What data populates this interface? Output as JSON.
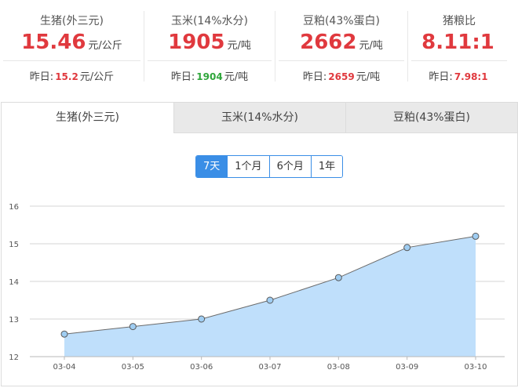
{
  "stats": [
    {
      "name": "生猪(外三元)",
      "value": "15.46",
      "unit": "元/公斤",
      "prev_label": "昨日:",
      "prev_value": "15.2",
      "prev_unit": "元/公斤",
      "prev_color": "red"
    },
    {
      "name": "玉米(14%水分)",
      "value": "1905",
      "unit": "元/吨",
      "prev_label": "昨日:",
      "prev_value": "1904",
      "prev_unit": "元/吨",
      "prev_color": "green"
    },
    {
      "name": "豆粕(43%蛋白)",
      "value": "2662",
      "unit": "元/吨",
      "prev_label": "昨日:",
      "prev_value": "2659",
      "prev_unit": "元/吨",
      "prev_color": "red"
    },
    {
      "name": "猪粮比",
      "value": "8.11:1",
      "unit": "",
      "prev_label": "昨日:",
      "prev_value": "7.98:1",
      "prev_unit": "",
      "prev_color": "red"
    }
  ],
  "tabs": [
    {
      "label": "生猪(外三元)",
      "active": true
    },
    {
      "label": "玉米(14%水分)",
      "active": false
    },
    {
      "label": "豆粕(43%蛋白)",
      "active": false
    }
  ],
  "ranges": [
    {
      "label": "7天",
      "active": true
    },
    {
      "label": "1个月",
      "active": false
    },
    {
      "label": "6个月",
      "active": false
    },
    {
      "label": "1年",
      "active": false
    }
  ],
  "colors": {
    "accent": "#3a8ee6",
    "price_red": "#e0393e",
    "price_green": "#2fa63b",
    "area_fill": "#bfdffb",
    "line": "#6b6b6b",
    "point_fill": "#9fcdf2"
  },
  "chart_data": {
    "type": "area",
    "title": "",
    "xlabel": "",
    "ylabel": "",
    "categories": [
      "03-04",
      "03-05",
      "03-06",
      "03-07",
      "03-08",
      "03-09",
      "03-10"
    ],
    "series": [
      {
        "values": [
          12.6,
          12.8,
          13.0,
          13.5,
          14.1,
          14.9,
          15.2
        ]
      }
    ],
    "ylim": [
      12,
      16
    ],
    "yticks": [
      12,
      13,
      14,
      15,
      16
    ],
    "grid": true,
    "legend": "none"
  }
}
